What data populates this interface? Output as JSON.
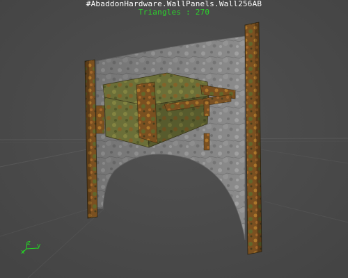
{
  "viewport": {
    "mesh_name": "#AbaddonHardware.WallPanels.Wall256AB",
    "triangles_text": "Triangles : 270",
    "axis_labels": {
      "x": "x",
      "y": "y",
      "z": "z"
    },
    "colors": {
      "background": "#4b4b4b",
      "grid": "#5c5c5c",
      "mesh_name_text": "#ffffff",
      "triangle_text": "#2bd42b",
      "axis": "#22dd22",
      "stone": "#8f8f8f",
      "rust": "#8a5a1e",
      "moss": "#6e7a3a"
    }
  }
}
